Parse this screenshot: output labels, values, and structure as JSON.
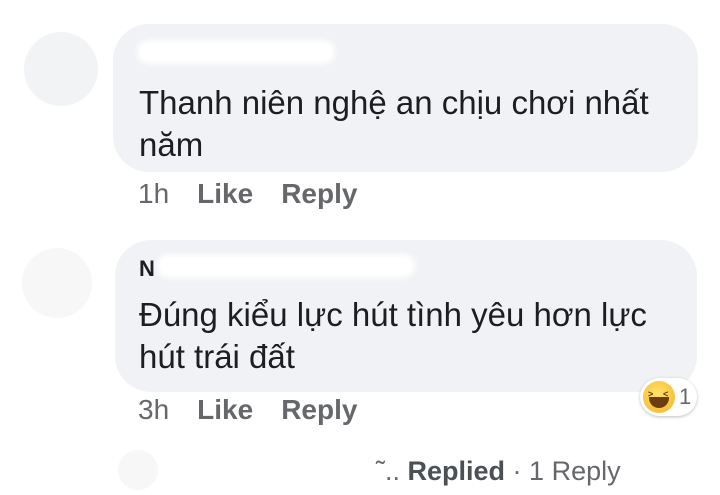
{
  "comments": [
    {
      "name_fragment": "",
      "text": "Thanh niên nghệ an chịu chơi nhất\nnăm",
      "time": "1h",
      "like": "Like",
      "reply": "Reply"
    },
    {
      "name_fragment": "N",
      "text": "Đúng kiểu lực hút tình yêu hơn lực\nhút trái đất",
      "time": "3h",
      "like": "Like",
      "reply": "Reply",
      "reaction": {
        "icon": "laughing-emoji-icon",
        "count": "1"
      }
    }
  ],
  "replies_link": {
    "prefix": "˜..",
    "label": "Replied",
    "separator": " · ",
    "count_label": "1 Reply"
  }
}
